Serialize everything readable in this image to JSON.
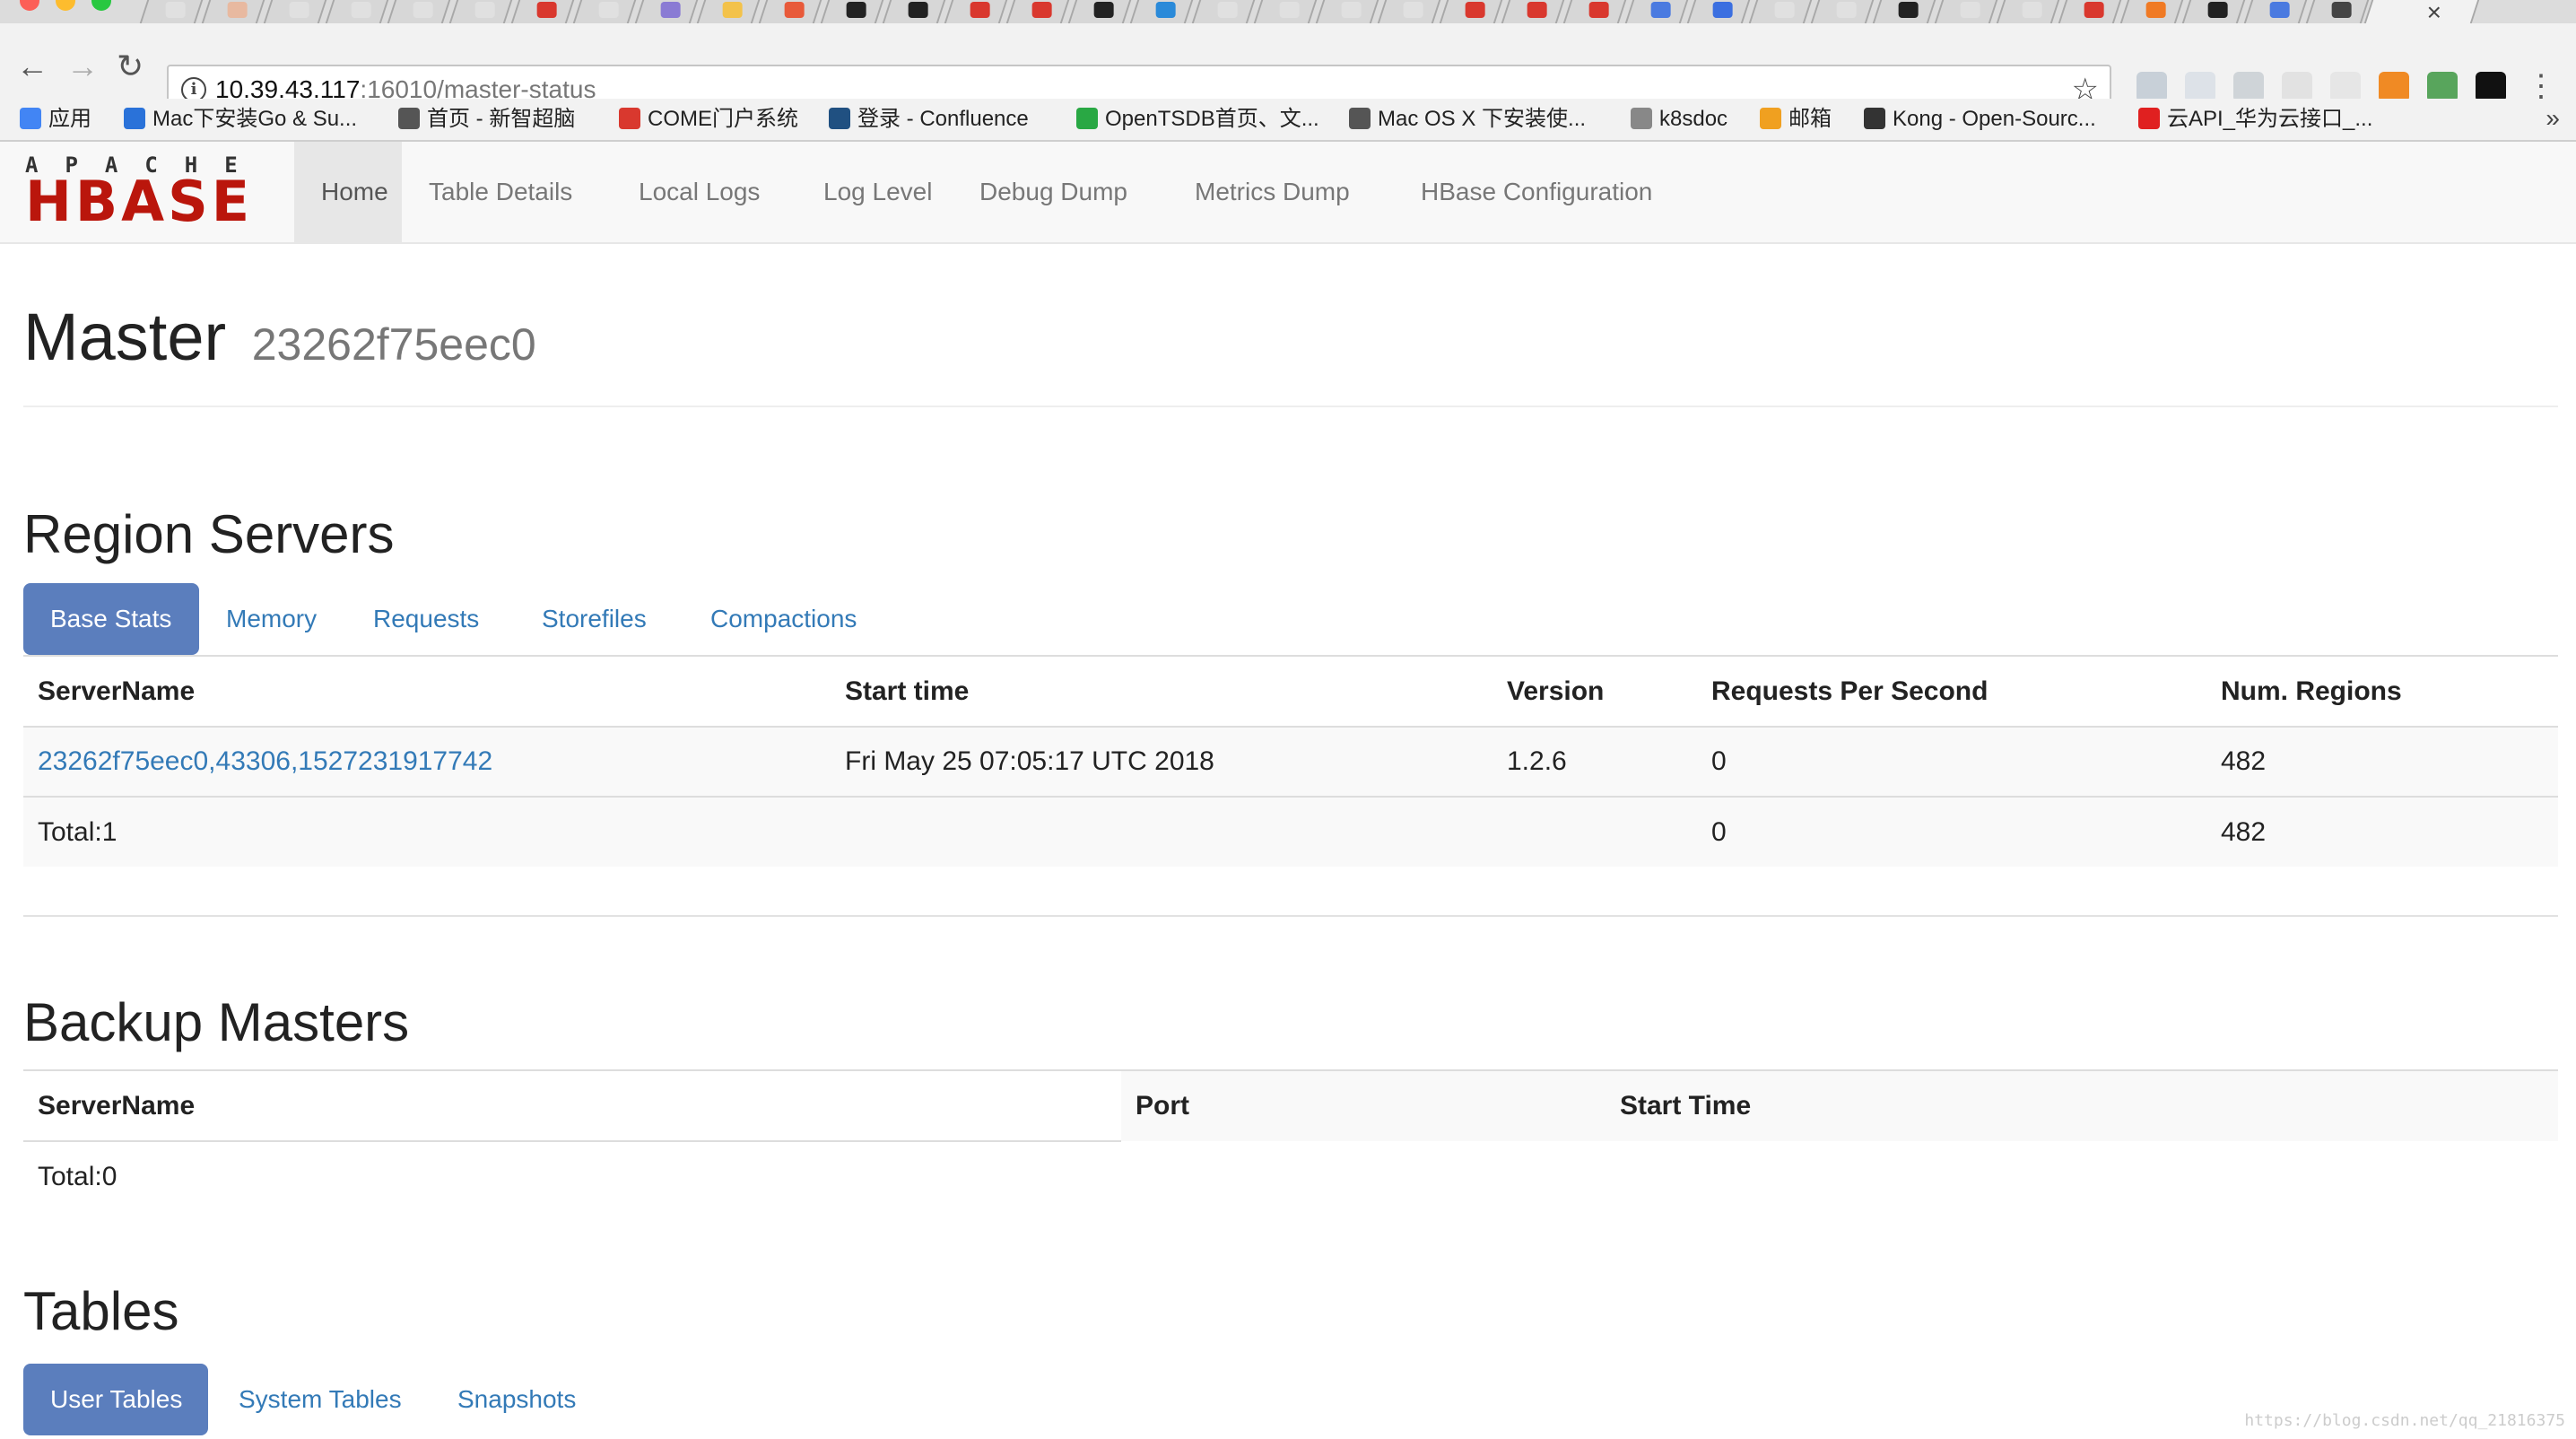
{
  "browser": {
    "url_host": "10.39.43.117",
    "url_path": ":16010/master-status",
    "colors": {
      "tabstrip": "#dcdcdc",
      "toolbar": "#f2f2f2"
    }
  },
  "bookmarks": [
    {
      "label": "应用",
      "icon": "apps-grid-icon",
      "color": "#4285f4"
    },
    {
      "label": "Mac下安装Go & Su...",
      "icon": "c-blue-icon",
      "color": "#2a72d9"
    },
    {
      "label": "首页 - 新智超脑",
      "icon": "edit-page-icon",
      "color": "#555555"
    },
    {
      "label": "COME门户系统",
      "icon": "red-dot-icon",
      "color": "#d9382e"
    },
    {
      "label": "登录 - Confluence",
      "icon": "confluence-icon",
      "color": "#205081"
    },
    {
      "label": "OpenTSDB首页、文...",
      "icon": "c-green-icon",
      "color": "#29a844"
    },
    {
      "label": "Mac OS X 下安装使...",
      "icon": "edit-page-icon",
      "color": "#555555"
    },
    {
      "label": "k8sdoc",
      "icon": "page-icon",
      "color": "#888888"
    },
    {
      "label": "邮箱",
      "icon": "mail-icon",
      "color": "#f0a020"
    },
    {
      "label": "Kong - Open-Sourc...",
      "icon": "kong-icon",
      "color": "#333333"
    },
    {
      "label": "云API_华为云接口_...",
      "icon": "huawei-icon",
      "color": "#e02020"
    }
  ],
  "navbar": {
    "logo_top": "APACHE",
    "logo_main": "HBASE",
    "items": [
      "Home",
      "Table Details",
      "Local Logs",
      "Log Level",
      "Debug Dump",
      "Metrics Dump",
      "HBase Configuration"
    ]
  },
  "master": {
    "title": "Master",
    "host": "23262f75eec0"
  },
  "region_servers": {
    "title": "Region Servers",
    "tabs": [
      "Base Stats",
      "Memory",
      "Requests",
      "Storefiles",
      "Compactions"
    ],
    "columns": [
      "ServerName",
      "Start time",
      "Version",
      "Requests Per Second",
      "Num. Regions"
    ],
    "rows": [
      [
        "23262f75eec0,43306,1527231917742",
        "Fri May 25 07:05:17 UTC 2018",
        "1.2.6",
        "0",
        "482"
      ]
    ],
    "total": [
      "Total:1",
      "",
      "",
      "0",
      "482"
    ]
  },
  "backup_masters": {
    "title": "Backup Masters",
    "columns": [
      "ServerName",
      "Port",
      "Start Time"
    ],
    "total": "Total:0"
  },
  "tables": {
    "title": "Tables",
    "tabs": [
      "User Tables",
      "System Tables",
      "Snapshots"
    ]
  },
  "watermark": "https://blog.csdn.net/qq_21816375"
}
